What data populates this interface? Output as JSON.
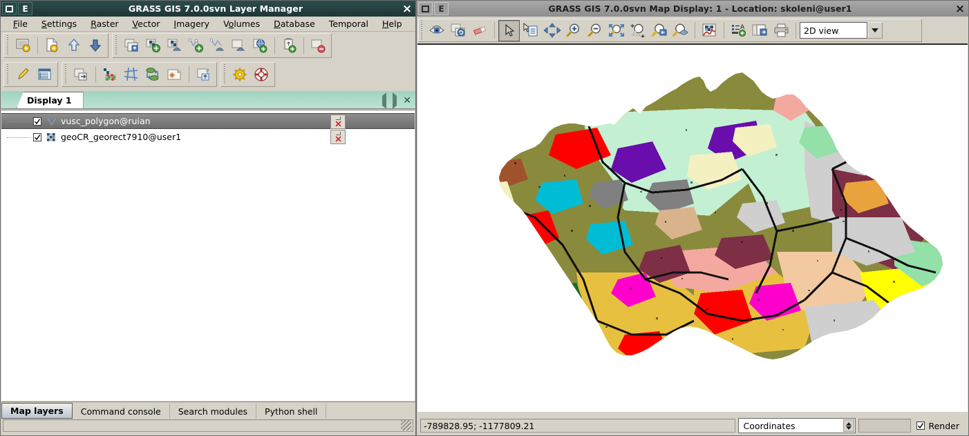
{
  "layer_manager": {
    "title": "GRASS GIS 7.0.0svn Layer Manager",
    "window_icon_letter": "E",
    "close_label": "×",
    "menus": [
      {
        "pre": "",
        "key": "F",
        "post": "ile"
      },
      {
        "pre": "",
        "key": "S",
        "post": "ettings"
      },
      {
        "pre": "",
        "key": "R",
        "post": "aster"
      },
      {
        "pre": "",
        "key": "V",
        "post": "ector"
      },
      {
        "pre": "",
        "key": "I",
        "post": "magery"
      },
      {
        "pre": "V",
        "key": "o",
        "post": "lumes"
      },
      {
        "pre": "",
        "key": "D",
        "post": "atabase"
      },
      {
        "pre": "T",
        "key": "",
        "post": "emporal"
      },
      {
        "pre": "",
        "key": "H",
        "post": "elp"
      }
    ],
    "toolbar_row1": [
      {
        "name": "start-new-display-icon",
        "title": "Start new map display"
      },
      {
        "name": "create-new-workspace-icon",
        "title": "Create new workspace"
      },
      {
        "name": "open-workspace-icon",
        "title": "Open existing workspace file"
      },
      {
        "name": "save-workspace-icon",
        "title": "Save current workspace to file"
      },
      {
        "name": "add-multiple-raster-vector-icon",
        "title": "Add multiple raster or vector map layers"
      },
      {
        "name": "add-raster-layer-icon",
        "title": "Add raster map layer"
      },
      {
        "name": "add-various-raster-icon",
        "title": "Add various raster map layers"
      },
      {
        "name": "add-vector-layer-icon",
        "title": "Add vector map layer"
      },
      {
        "name": "add-various-vector-icon",
        "title": "Add various vector map layers"
      },
      {
        "name": "add-group-icon",
        "title": "Add group"
      },
      {
        "name": "add-web-service-icon",
        "title": "Add web service layer"
      },
      {
        "name": "add-command-layer-icon",
        "title": "Add command layer"
      },
      {
        "name": "remove-layer-icon",
        "title": "Remove selected map layer"
      }
    ],
    "toolbar_row2": [
      {
        "name": "edit-vector-maps-icon",
        "title": "Edit vector maps"
      },
      {
        "name": "show-attribute-table-icon",
        "title": "Show attribute data"
      },
      {
        "name": "import-raster-data-icon",
        "title": "Import raster data"
      },
      {
        "name": "raster-map-calculator-icon",
        "title": "Raster map calculator"
      },
      {
        "name": "build-vector-topology-icon",
        "title": "Build vector topology"
      },
      {
        "name": "georectify-icon",
        "title": "Georectify"
      },
      {
        "name": "cartographic-composer-icon",
        "title": "Cartographic composer"
      },
      {
        "name": "launch-script-icon",
        "title": "Launch script"
      },
      {
        "name": "gui-settings-icon",
        "title": "GUI settings"
      },
      {
        "name": "help-icon",
        "title": "Show manual"
      }
    ],
    "notebook": {
      "tab_label": "Display 1",
      "nav_prev": "prev-display",
      "nav_next": "next-display",
      "nav_close": "close-display"
    },
    "layers": [
      {
        "name": "vusc_polygon@ruian",
        "type": "vector",
        "checked": true,
        "selected": true
      },
      {
        "name": "geoCR_georect7910@user1",
        "type": "raster",
        "checked": true,
        "selected": false
      }
    ],
    "bottom_tabs": [
      {
        "label": "Map layers",
        "active": true
      },
      {
        "label": "Command console",
        "active": false
      },
      {
        "label": "Search modules",
        "active": false
      },
      {
        "label": "Python shell",
        "active": false
      }
    ],
    "status_text": ""
  },
  "map_display": {
    "title": "GRASS GIS 7.0.0svn Map Display: 1  - Location: skoleni@user1",
    "window_icon_letter": "E",
    "close_label": "×",
    "toolbar": [
      {
        "name": "display-map-icon",
        "title": "Display map"
      },
      {
        "name": "render-map-icon",
        "title": "Re-render map"
      },
      {
        "name": "erase-display-icon",
        "title": "Erase display"
      },
      {
        "name": "pointer-icon",
        "title": "Pointer",
        "pressed": true
      },
      {
        "name": "query-raster-vector-icon",
        "title": "Query raster/vector map(s)"
      },
      {
        "name": "pan-icon",
        "title": "Pan"
      },
      {
        "name": "zoom-in-icon",
        "title": "Zoom in"
      },
      {
        "name": "zoom-out-icon",
        "title": "Zoom out"
      },
      {
        "name": "zoom-to-selected-icon",
        "title": "Zoom to selected map layers"
      },
      {
        "name": "zoom-to-extent-icon",
        "title": "Various zoom options"
      },
      {
        "name": "zoom-back-icon",
        "title": "Return to previous zoom"
      },
      {
        "name": "zoom-options-icon",
        "title": "Zoom options"
      },
      {
        "name": "analyze-map-icon",
        "title": "Analyze map"
      },
      {
        "name": "add-map-elements-icon",
        "title": "Add map elements"
      },
      {
        "name": "save-display-to-file-icon",
        "title": "Save display to file"
      },
      {
        "name": "print-map-icon",
        "title": "Print map"
      }
    ],
    "view_mode": {
      "value": "2D view",
      "dropdown_icon": "chevron-down-icon"
    },
    "status": {
      "coordinates": "-789828.95; -1177809.21",
      "mode_value": "Coordinates",
      "render_label": "Render",
      "render_checked": true
    }
  },
  "map_colors": {
    "background": "#ffffff",
    "outline": "#000000",
    "palette": [
      "#8a8a3c",
      "#c3f0d2",
      "#cfcfcf",
      "#e8a33d",
      "#f4a9a0",
      "#e8c040",
      "#f0d080",
      "#7d2f46",
      "#ffff00",
      "#ff0000",
      "#6a0dad",
      "#00bcd4",
      "#ff00cc",
      "#a0522d",
      "#f5f0c0",
      "#93e0a8",
      "#d9b38c",
      "#808080",
      "#f2c9a0",
      "#e0d070",
      "#1b6b2b",
      "#b0b0b0"
    ]
  }
}
